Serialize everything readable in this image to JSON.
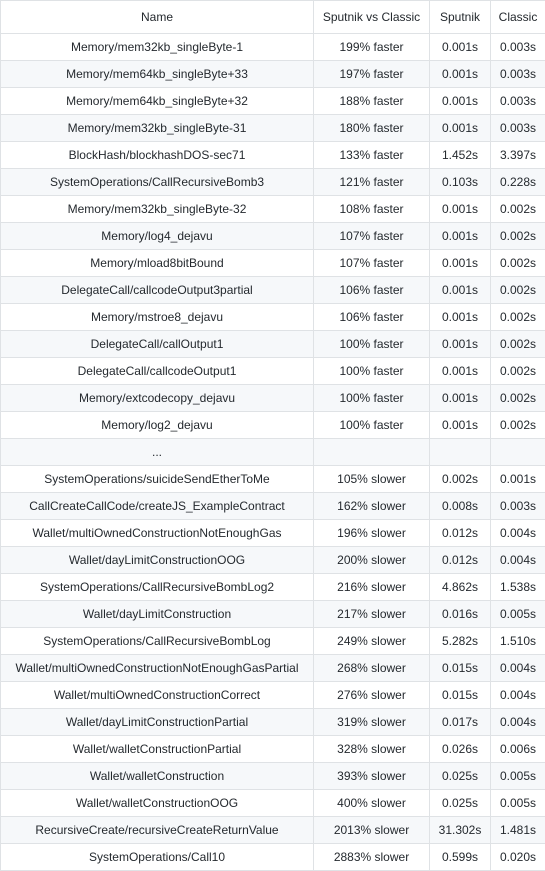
{
  "table": {
    "headers": [
      "Name",
      "Sputnik vs Classic",
      "Sputnik",
      "Classic"
    ],
    "rows": [
      [
        "Memory/mem32kb_singleByte-1",
        "199% faster",
        "0.001s",
        "0.003s"
      ],
      [
        "Memory/mem64kb_singleByte+33",
        "197% faster",
        "0.001s",
        "0.003s"
      ],
      [
        "Memory/mem64kb_singleByte+32",
        "188% faster",
        "0.001s",
        "0.003s"
      ],
      [
        "Memory/mem32kb_singleByte-31",
        "180% faster",
        "0.001s",
        "0.003s"
      ],
      [
        "BlockHash/blockhashDOS-sec71",
        "133% faster",
        "1.452s",
        "3.397s"
      ],
      [
        "SystemOperations/CallRecursiveBomb3",
        "121% faster",
        "0.103s",
        "0.228s"
      ],
      [
        "Memory/mem32kb_singleByte-32",
        "108% faster",
        "0.001s",
        "0.002s"
      ],
      [
        "Memory/log4_dejavu",
        "107% faster",
        "0.001s",
        "0.002s"
      ],
      [
        "Memory/mload8bitBound",
        "107% faster",
        "0.001s",
        "0.002s"
      ],
      [
        "DelegateCall/callcodeOutput3partial",
        "106% faster",
        "0.001s",
        "0.002s"
      ],
      [
        "Memory/mstroe8_dejavu",
        "106% faster",
        "0.001s",
        "0.002s"
      ],
      [
        "DelegateCall/callOutput1",
        "100% faster",
        "0.001s",
        "0.002s"
      ],
      [
        "DelegateCall/callcodeOutput1",
        "100% faster",
        "0.001s",
        "0.002s"
      ],
      [
        "Memory/extcodecopy_dejavu",
        "100% faster",
        "0.001s",
        "0.002s"
      ],
      [
        "Memory/log2_dejavu",
        "100% faster",
        "0.001s",
        "0.002s"
      ],
      [
        "...",
        "",
        "",
        ""
      ],
      [
        "SystemOperations/suicideSendEtherToMe",
        "105% slower",
        "0.002s",
        "0.001s"
      ],
      [
        "CallCreateCallCode/createJS_ExampleContract",
        "162% slower",
        "0.008s",
        "0.003s"
      ],
      [
        "Wallet/multiOwnedConstructionNotEnoughGas",
        "196% slower",
        "0.012s",
        "0.004s"
      ],
      [
        "Wallet/dayLimitConstructionOOG",
        "200% slower",
        "0.012s",
        "0.004s"
      ],
      [
        "SystemOperations/CallRecursiveBombLog2",
        "216% slower",
        "4.862s",
        "1.538s"
      ],
      [
        "Wallet/dayLimitConstruction",
        "217% slower",
        "0.016s",
        "0.005s"
      ],
      [
        "SystemOperations/CallRecursiveBombLog",
        "249% slower",
        "5.282s",
        "1.510s"
      ],
      [
        "Wallet/multiOwnedConstructionNotEnoughGasPartial",
        "268% slower",
        "0.015s",
        "0.004s"
      ],
      [
        "Wallet/multiOwnedConstructionCorrect",
        "276% slower",
        "0.015s",
        "0.004s"
      ],
      [
        "Wallet/dayLimitConstructionPartial",
        "319% slower",
        "0.017s",
        "0.004s"
      ],
      [
        "Wallet/walletConstructionPartial",
        "328% slower",
        "0.026s",
        "0.006s"
      ],
      [
        "Wallet/walletConstruction",
        "393% slower",
        "0.025s",
        "0.005s"
      ],
      [
        "Wallet/walletConstructionOOG",
        "400% slower",
        "0.025s",
        "0.005s"
      ],
      [
        "RecursiveCreate/recursiveCreateReturnValue",
        "2013% slower",
        "31.302s",
        "1.481s"
      ],
      [
        "SystemOperations/Call10",
        "2883% slower",
        "0.599s",
        "0.020s"
      ]
    ]
  }
}
